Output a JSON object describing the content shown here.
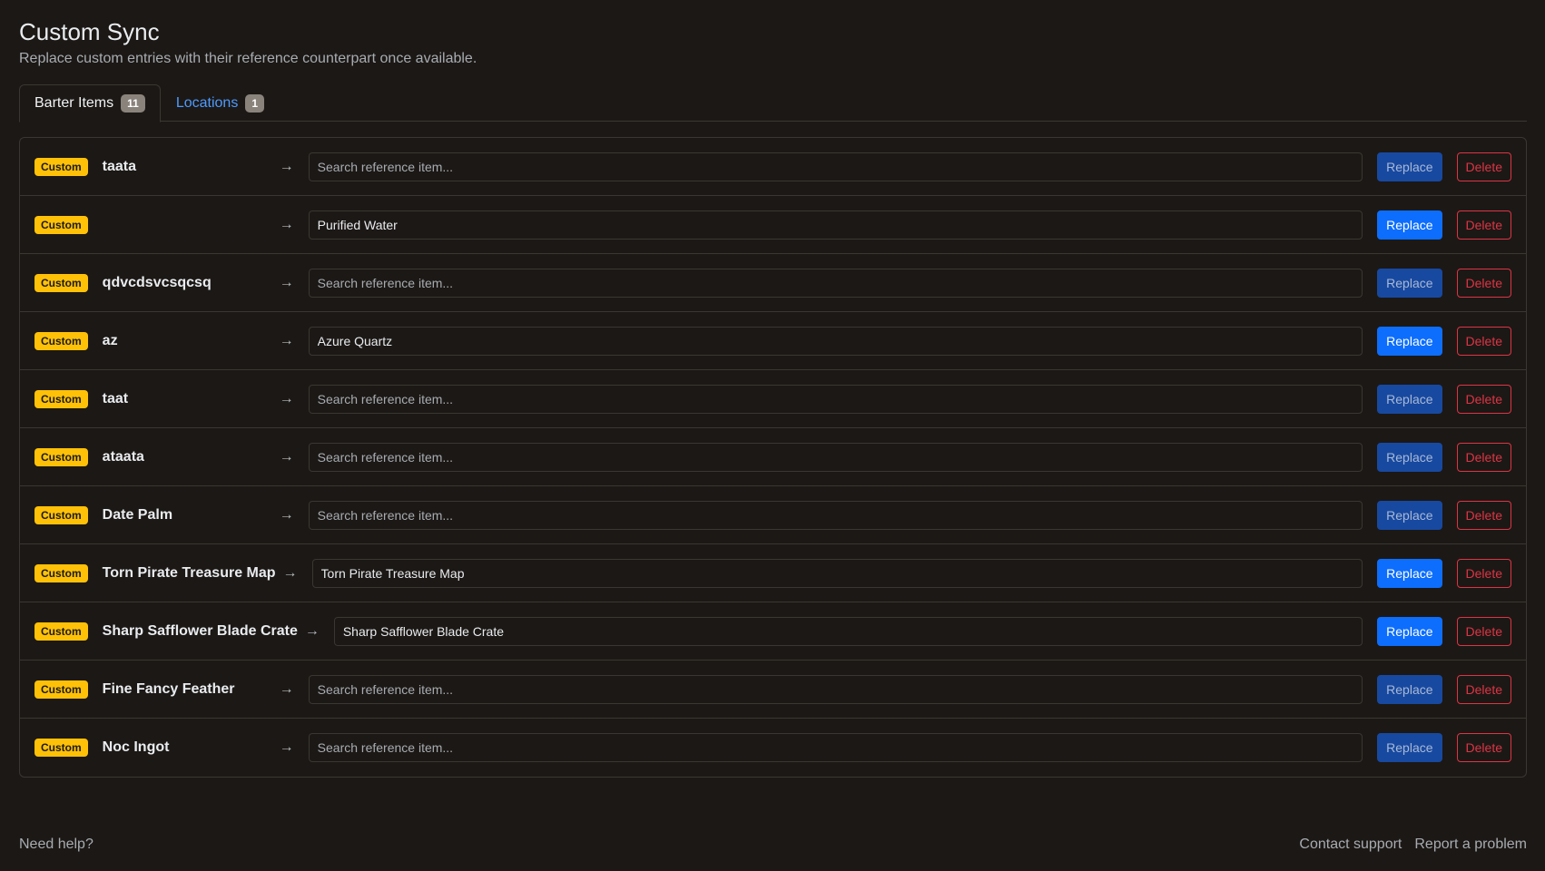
{
  "header": {
    "title": "Custom Sync",
    "subtitle": "Replace custom entries with their reference counterpart once available."
  },
  "tabs": [
    {
      "label": "Barter Items",
      "count": "11",
      "active": true
    },
    {
      "label": "Locations",
      "count": "1",
      "active": false
    }
  ],
  "rows": [
    {
      "badge": "Custom",
      "name": "taata",
      "arrow": "→",
      "value": "",
      "placeholder": "Search reference item...",
      "replace": "Replace",
      "delete": "Delete",
      "replace_enabled": false
    },
    {
      "badge": "Custom",
      "name": "",
      "arrow": "→",
      "value": "Purified Water",
      "placeholder": "Search reference item...",
      "replace": "Replace",
      "delete": "Delete",
      "replace_enabled": true
    },
    {
      "badge": "Custom",
      "name": "qdvcdsvcsqcsq",
      "arrow": "→",
      "value": "",
      "placeholder": "Search reference item...",
      "replace": "Replace",
      "delete": "Delete",
      "replace_enabled": false
    },
    {
      "badge": "Custom",
      "name": "az",
      "arrow": "→",
      "value": "Azure Quartz",
      "placeholder": "Search reference item...",
      "replace": "Replace",
      "delete": "Delete",
      "replace_enabled": true
    },
    {
      "badge": "Custom",
      "name": "taat",
      "arrow": "→",
      "value": "",
      "placeholder": "Search reference item...",
      "replace": "Replace",
      "delete": "Delete",
      "replace_enabled": false
    },
    {
      "badge": "Custom",
      "name": "ataata",
      "arrow": "→",
      "value": "",
      "placeholder": "Search reference item...",
      "replace": "Replace",
      "delete": "Delete",
      "replace_enabled": false
    },
    {
      "badge": "Custom",
      "name": "Date Palm",
      "arrow": "→",
      "value": "",
      "placeholder": "Search reference item...",
      "replace": "Replace",
      "delete": "Delete",
      "replace_enabled": false
    },
    {
      "badge": "Custom",
      "name": "Torn Pirate Treasure Map",
      "arrow": "→",
      "value": "Torn Pirate Treasure Map",
      "placeholder": "Search reference item...",
      "replace": "Replace",
      "delete": "Delete",
      "replace_enabled": true
    },
    {
      "badge": "Custom",
      "name": "Sharp Safflower Blade Crate",
      "arrow": "→",
      "value": "Sharp Safflower Blade Crate",
      "placeholder": "Search reference item...",
      "replace": "Replace",
      "delete": "Delete",
      "replace_enabled": true
    },
    {
      "badge": "Custom",
      "name": "Fine Fancy Feather",
      "arrow": "→",
      "value": "",
      "placeholder": "Search reference item...",
      "replace": "Replace",
      "delete": "Delete",
      "replace_enabled": false
    },
    {
      "badge": "Custom",
      "name": "Noc Ingot",
      "arrow": "→",
      "value": "",
      "placeholder": "Search reference item...",
      "replace": "Replace",
      "delete": "Delete",
      "replace_enabled": false
    }
  ],
  "footer": {
    "help": "Need help?",
    "contact": "Contact support",
    "report": "Report a problem"
  },
  "colors": {
    "background": "#1c1815",
    "badge": "#ffc107",
    "primary": "#0d6efd",
    "danger": "#dc3545",
    "tab_link": "#4d9bff"
  }
}
